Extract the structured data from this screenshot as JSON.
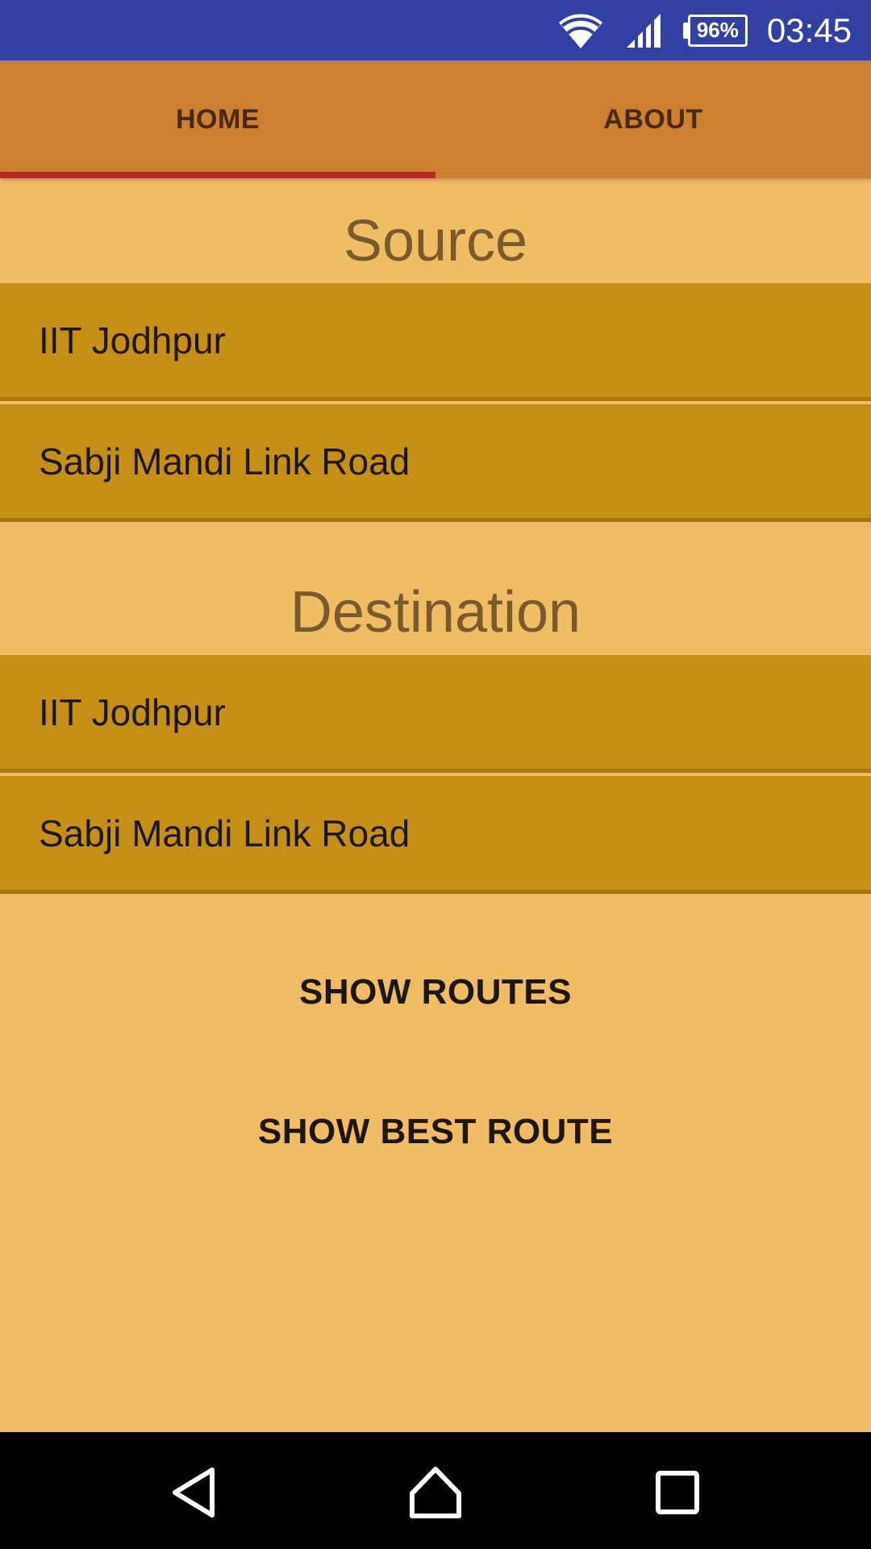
{
  "status_bar": {
    "battery": "96%",
    "time": "03:45",
    "icons": [
      "wifi-icon",
      "signal-icon",
      "battery-icon"
    ]
  },
  "tabs": [
    {
      "label": "HOME",
      "selected": true
    },
    {
      "label": "ABOUT",
      "selected": false
    }
  ],
  "source": {
    "title": "Source",
    "items": [
      "IIT Jodhpur",
      "Sabji Mandi Link Road"
    ]
  },
  "destination": {
    "title": "Destination",
    "items": [
      "IIT Jodhpur",
      "Sabji Mandi Link Road"
    ]
  },
  "actions": {
    "show_routes": "SHOW ROUTES",
    "show_best_route": "SHOW BEST ROUTE"
  },
  "nav_bar": {
    "icons": [
      "back-icon",
      "home-icon",
      "recents-icon"
    ]
  },
  "colors": {
    "status_bar": "#3340a3",
    "tab_bar": "#cd7f32",
    "tab_indicator": "#b52a23",
    "background": "#f1bc66",
    "list_item": "#c69017",
    "title_text": "#7a5a2a"
  }
}
